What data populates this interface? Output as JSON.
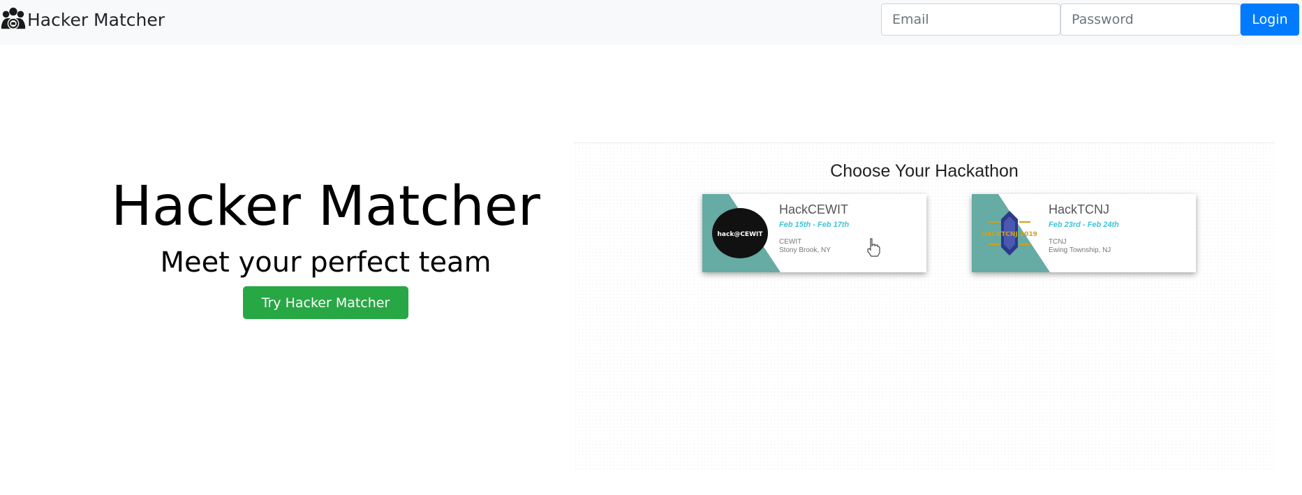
{
  "navbar": {
    "brand": "Hacker Matcher",
    "logo_icon": "hacker-group-icon",
    "email_placeholder": "Email",
    "password_placeholder": "Password",
    "login_label": "Login"
  },
  "hero": {
    "title": "Hacker Matcher",
    "subtitle": "Meet your perfect team",
    "cta_label": "Try Hacker Matcher"
  },
  "demo": {
    "heading": "Choose Your Hackathon",
    "cards": [
      {
        "name": "HackCEWIT",
        "dates": "Feb 15th - Feb 17th",
        "host": "CEWIT",
        "location": "Stony Brook, NY",
        "logo_text": "hack@CEWIT"
      },
      {
        "name": "HackTCNJ",
        "dates": "Feb 23rd - Feb 24th",
        "host": "TCNJ",
        "location": "Ewing Township, NJ",
        "logo_text": "HACKTCNJ 2019"
      }
    ]
  },
  "colors": {
    "navbar_bg": "#f8f9fa",
    "login_button": "#007bff",
    "cta_button": "#28a745",
    "card_band": "#66aba4",
    "date_text": "#3cc4d8"
  }
}
